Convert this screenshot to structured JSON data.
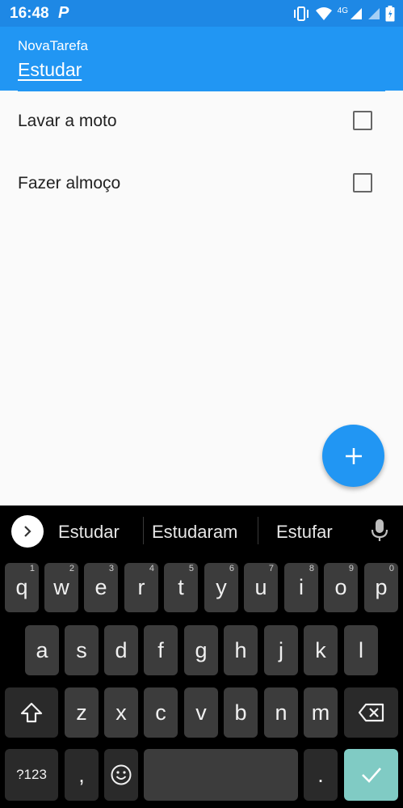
{
  "status_bar": {
    "time": "16:48",
    "notification_glyph": "P",
    "network_label": "4G",
    "icons": [
      "vibrate-icon",
      "wifi-icon",
      "signal-icon",
      "signal-icon",
      "battery-icon"
    ]
  },
  "app_bar": {
    "title": "NovaTarefa",
    "input_value": "Estudar"
  },
  "tasks": [
    {
      "label": "Lavar a moto",
      "checked": false
    },
    {
      "label": "Fazer almoço",
      "checked": false
    }
  ],
  "fab": {
    "icon": "plus-icon"
  },
  "keyboard": {
    "suggestions": [
      "Estudar",
      "Estudaram",
      "Estufar"
    ],
    "row1": [
      {
        "key": "q",
        "hint": "1"
      },
      {
        "key": "w",
        "hint": "2"
      },
      {
        "key": "e",
        "hint": "3"
      },
      {
        "key": "r",
        "hint": "4"
      },
      {
        "key": "t",
        "hint": "5"
      },
      {
        "key": "y",
        "hint": "6"
      },
      {
        "key": "u",
        "hint": "7"
      },
      {
        "key": "i",
        "hint": "8"
      },
      {
        "key": "o",
        "hint": "9"
      },
      {
        "key": "p",
        "hint": "0"
      }
    ],
    "row2": [
      "a",
      "s",
      "d",
      "f",
      "g",
      "h",
      "j",
      "k",
      "l"
    ],
    "row3": [
      "z",
      "x",
      "c",
      "v",
      "b",
      "n",
      "m"
    ],
    "symbols_label": "?123",
    "comma_label": ",",
    "period_label": "."
  },
  "colors": {
    "primary": "#2196f3",
    "status_bar": "#1e88e5",
    "keyboard_bg": "#000000",
    "key_bg": "#3c3c3c",
    "enter_key": "#80cbc4"
  }
}
